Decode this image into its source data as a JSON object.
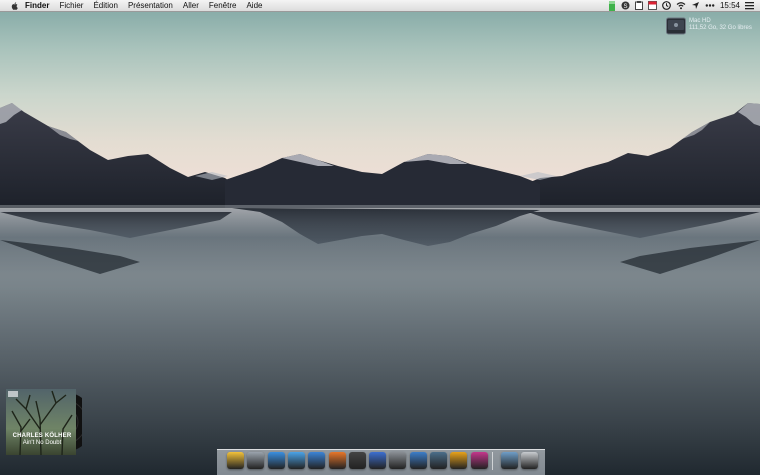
{
  "menubar": {
    "app_name": "Finder",
    "items": [
      "Fichier",
      "Édition",
      "Présentation",
      "Aller",
      "Fenêtre",
      "Aide"
    ],
    "clock": "15:54",
    "status_icons": [
      "battery-icon",
      "skype-icon",
      "clipboard-icon",
      "calendar-icon",
      "clock-icon",
      "wifi-icon",
      "location-icon",
      "more-icon",
      "list-icon"
    ]
  },
  "desktop": {
    "disk": {
      "name": "Mac HD",
      "info": "111,52 Go, 32 Go libres"
    },
    "wallpaper": "mountain lake reflection"
  },
  "now_playing": {
    "artist": "CHARLES KÖLHER",
    "title": "Ain't No Doubt"
  },
  "dock": {
    "apps": [
      {
        "name": "ithings-icon",
        "color": "#f3c23a"
      },
      {
        "name": "launchpad-icon",
        "color": "#9aa3ad"
      },
      {
        "name": "safari-icon",
        "color": "#3b8fe0"
      },
      {
        "name": "mail-icon",
        "color": "#4aa3e8"
      },
      {
        "name": "xcode-icon",
        "color": "#3c84d6"
      },
      {
        "name": "firefox-icon",
        "color": "#e8772a"
      },
      {
        "name": "facetime-icon",
        "color": "#444444"
      },
      {
        "name": "itunes-icon",
        "color": "#3d6fd0"
      },
      {
        "name": "system-preferences-icon",
        "color": "#8a8f95"
      },
      {
        "name": "word-icon",
        "color": "#3d7ec9"
      },
      {
        "name": "tv-icon",
        "color": "#4b6e8a"
      },
      {
        "name": "sunflower-icon",
        "color": "#e8a21a"
      },
      {
        "name": "flower-icon",
        "color": "#c4378c"
      },
      {
        "name": "downloads-icon",
        "color": "#6f9ec8"
      },
      {
        "name": "trash-icon",
        "color": "#c8ccd0"
      }
    ]
  }
}
